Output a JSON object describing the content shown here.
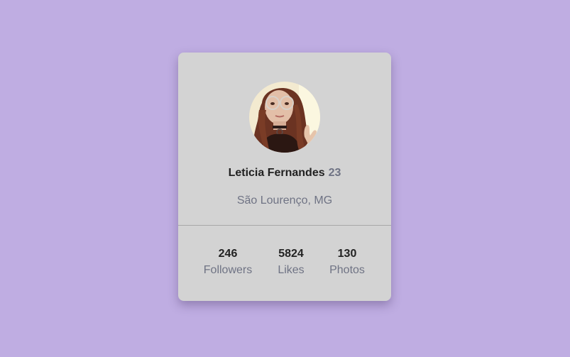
{
  "profile": {
    "name": "Leticia Fernandes",
    "age": "23",
    "location": "São Lourenço, MG",
    "avatar_icon": "profile-photo"
  },
  "stats": [
    {
      "value": "246",
      "label": "Followers"
    },
    {
      "value": "5824",
      "label": "Likes"
    },
    {
      "value": "130",
      "label": "Photos"
    }
  ],
  "colors": {
    "background": "#bfade2",
    "card": "#d3d3d3",
    "muted_text": "#6f7384",
    "strong_text": "#222222"
  }
}
